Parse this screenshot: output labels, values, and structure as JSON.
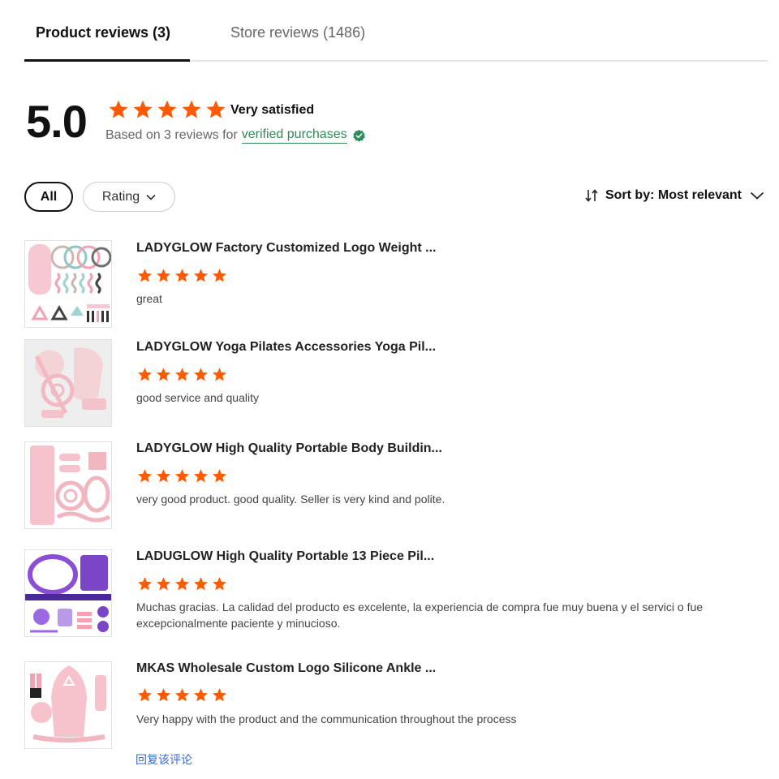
{
  "tabs": {
    "product": "Product reviews (3)",
    "store": "Store reviews (1486)"
  },
  "summary": {
    "score": "5.0",
    "label": "Very satisfied",
    "based_prefix": "Based on 3 reviews for",
    "verified": "verified purchases",
    "rating_stars": 5
  },
  "filters": {
    "all": "All",
    "rating": "Rating",
    "sort": "Sort by: Most relevant"
  },
  "colors": {
    "star": "#ff5a00",
    "verified": "#2e8b57",
    "link": "#3a6bc5"
  },
  "reviews": [
    {
      "title": "LADYGLOW Factory Customized Logo Weight ...",
      "rating": 5,
      "text": "great"
    },
    {
      "title": "LADYGLOW Yoga Pilates Accessories Yoga Pil...",
      "rating": 5,
      "text": "good service and quality"
    },
    {
      "title": "LADYGLOW High Quality Portable Body Buildin...",
      "rating": 5,
      "text": "very good product. good quality. Seller is very kind and polite."
    },
    {
      "title": "LADUGLOW High Quality Portable 13 Piece Pil...",
      "rating": 5,
      "text": "Muchas gracias. La calidad del producto es excelente, la experiencia de compra fue muy buena y el servici o fue excepcionalmente paciente y minucioso."
    },
    {
      "title": "MKAS Wholesale Custom Logo Silicone Ankle ...",
      "rating": 5,
      "text": "Very happy with the product and the communication throughout the process"
    }
  ],
  "reply_link": "回复该评论"
}
